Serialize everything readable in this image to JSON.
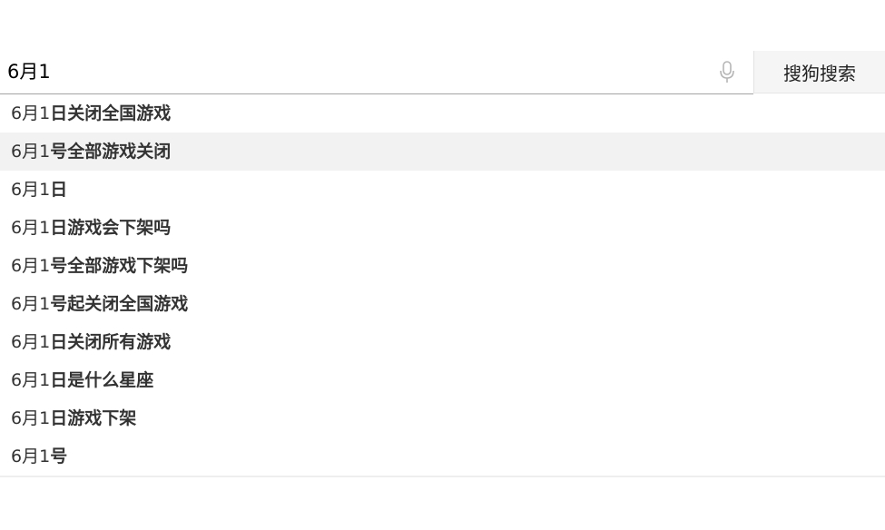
{
  "search": {
    "value": "6月1",
    "button_label": "搜狗搜索",
    "mic_icon": "microphone-icon"
  },
  "suggestions": [
    {
      "prefix": "6月1",
      "rest": "日关闭全国游戏"
    },
    {
      "prefix": "6月1",
      "rest": "号全部游戏关闭"
    },
    {
      "prefix": "6月1",
      "rest": "日"
    },
    {
      "prefix": "6月1",
      "rest": "日游戏会下架吗"
    },
    {
      "prefix": "6月1",
      "rest": "号全部游戏下架吗"
    },
    {
      "prefix": "6月1",
      "rest": "号起关闭全国游戏"
    },
    {
      "prefix": "6月1",
      "rest": "日关闭所有游戏"
    },
    {
      "prefix": "6月1",
      "rest": "日是什么星座"
    },
    {
      "prefix": "6月1",
      "rest": "日游戏下架"
    },
    {
      "prefix": "6月1",
      "rest": "号"
    }
  ],
  "colors": {
    "highlight_row": "#f2f2f2",
    "button_bg": "#f5f5f5",
    "text": "#333333",
    "underline": "#a3a3a3"
  }
}
